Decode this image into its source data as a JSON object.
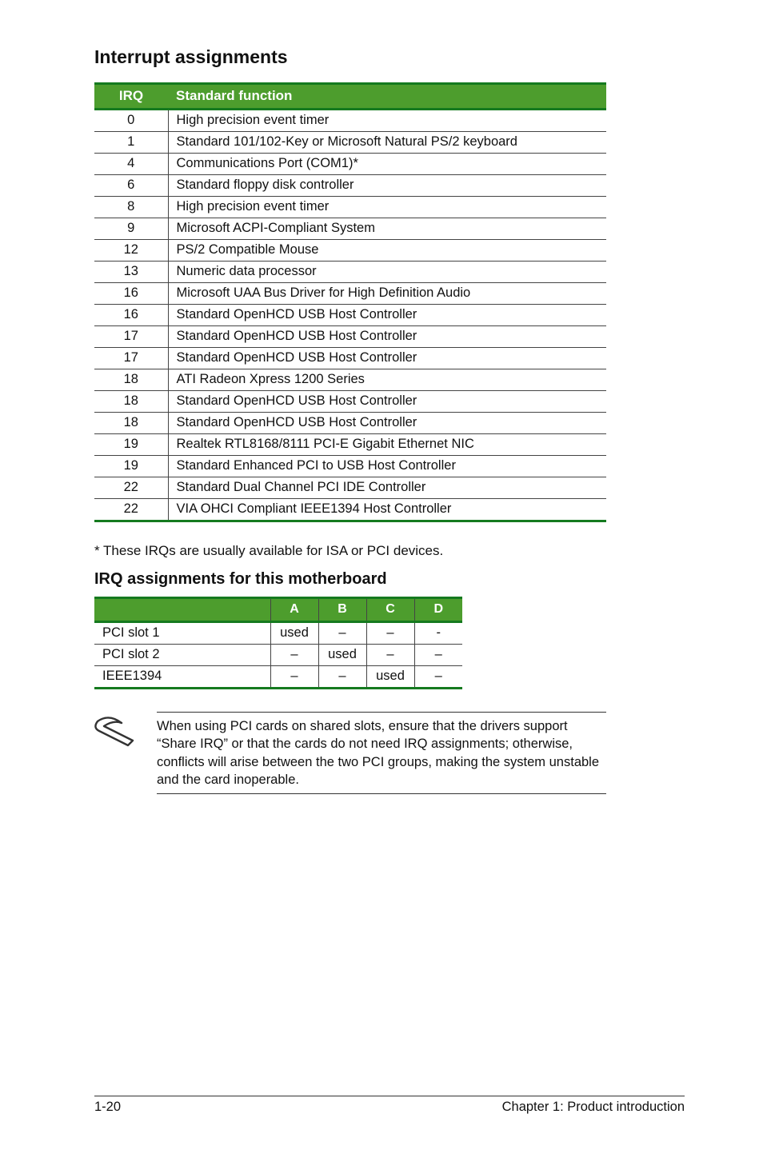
{
  "section_title": "Interrupt assignments",
  "irq_table": {
    "headers": [
      "IRQ",
      "Standard function"
    ],
    "rows": [
      {
        "irq": "0",
        "func": "High precision event timer"
      },
      {
        "irq": "1",
        "func": "Standard 101/102-Key or Microsoft Natural PS/2 keyboard"
      },
      {
        "irq": "4",
        "func": "Communications Port (COM1)*"
      },
      {
        "irq": "6",
        "func": "Standard floppy disk controller"
      },
      {
        "irq": "8",
        "func": "High precision event timer"
      },
      {
        "irq": "9",
        "func": "Microsoft ACPI-Compliant System"
      },
      {
        "irq": "12",
        "func": "PS/2 Compatible Mouse"
      },
      {
        "irq": "13",
        "func": "Numeric data processor"
      },
      {
        "irq": "16",
        "func": "Microsoft UAA Bus Driver for High Definition Audio"
      },
      {
        "irq": "16",
        "func": "Standard OpenHCD USB Host Controller"
      },
      {
        "irq": "17",
        "func": "Standard OpenHCD USB Host Controller"
      },
      {
        "irq": "17",
        "func": "Standard OpenHCD USB Host Controller"
      },
      {
        "irq": "18",
        "func": "ATI Radeon Xpress 1200 Series"
      },
      {
        "irq": "18",
        "func": "Standard OpenHCD USB Host Controller"
      },
      {
        "irq": "18",
        "func": "Standard OpenHCD USB Host Controller"
      },
      {
        "irq": "19",
        "func": "Realtek RTL8168/8111 PCI-E Gigabit Ethernet NIC"
      },
      {
        "irq": "19",
        "func": "Standard Enhanced PCI to USB Host Controller"
      },
      {
        "irq": "22",
        "func": "Standard Dual Channel PCI IDE Controller"
      },
      {
        "irq": "22",
        "func": "VIA OHCI Compliant IEEE1394 Host Controller"
      }
    ]
  },
  "footnote": "* These IRQs are usually available for ISA or PCI devices.",
  "sub_title": "IRQ assignments for this motherboard",
  "slot_table": {
    "headers": [
      "",
      "A",
      "B",
      "C",
      "D"
    ],
    "rows": [
      {
        "label": "PCI slot 1",
        "cells": [
          "used",
          "–",
          "–",
          "-"
        ]
      },
      {
        "label": "PCI slot 2",
        "cells": [
          "–",
          "used",
          "–",
          "–"
        ]
      },
      {
        "label": "IEEE1394",
        "cells": [
          "–",
          "–",
          "used",
          "–"
        ]
      }
    ]
  },
  "note": "When using PCI cards on shared slots, ensure that the drivers support “Share IRQ” or that the cards do not need IRQ assignments; otherwise, conflicts will arise between the two PCI groups, making the system unstable and the card inoperable.",
  "footer": {
    "left": "1-20",
    "right": "Chapter 1: Product introduction"
  }
}
